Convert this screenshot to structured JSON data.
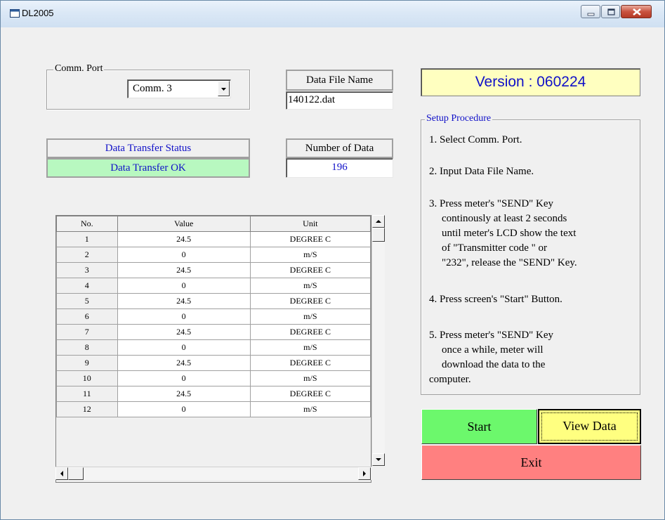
{
  "window": {
    "title": "DL2005",
    "icon": "app-icon"
  },
  "comm_port": {
    "caption": "Comm. Port",
    "selected": "Comm. 3"
  },
  "data_file": {
    "label": "Data File Name",
    "value": "140122.dat"
  },
  "version": {
    "text": "Version : 060224"
  },
  "transfer": {
    "label": "Data Transfer Status",
    "status": "Data Transfer OK",
    "status_bg": "#b8f8c0",
    "text_color": "#1010c8"
  },
  "count": {
    "label": "Number of  Data",
    "value": "196"
  },
  "table": {
    "headers": [
      "No.",
      "Value",
      "Unit"
    ],
    "rows": [
      [
        "1",
        "24.5",
        "DEGREE C"
      ],
      [
        "2",
        "0",
        "m/S"
      ],
      [
        "3",
        "24.5",
        "DEGREE C"
      ],
      [
        "4",
        "0",
        "m/S"
      ],
      [
        "5",
        "24.5",
        "DEGREE C"
      ],
      [
        "6",
        "0",
        "m/S"
      ],
      [
        "7",
        "24.5",
        "DEGREE C"
      ],
      [
        "8",
        "0",
        "m/S"
      ],
      [
        "9",
        "24.5",
        "DEGREE C"
      ],
      [
        "10",
        "0",
        "m/S"
      ],
      [
        "11",
        "24.5",
        "DEGREE C"
      ],
      [
        "12",
        "0",
        "m/S"
      ]
    ]
  },
  "setup": {
    "caption": "Setup Procedure",
    "steps": [
      "1. Select Comm. Port.",
      "2. Input Data File Name.",
      "3. Press meter's \"SEND\" Key",
      "continously at least 2 seconds",
      "until meter's LCD show the text",
      "of  \"Transmitter code \" or",
      "\"232\", release the \"SEND\" Key.",
      "4. Press screen's \"Start\" Button.",
      "5. Press meter's \"SEND\" Key",
      "once a while, meter will",
      "download the data to the",
      "computer."
    ]
  },
  "buttons": {
    "start": {
      "label": "Start",
      "color": "#6cf86c"
    },
    "view": {
      "label": "View Data",
      "color": "#ffff80"
    },
    "exit": {
      "label": "Exit",
      "color": "#ff8080"
    }
  }
}
